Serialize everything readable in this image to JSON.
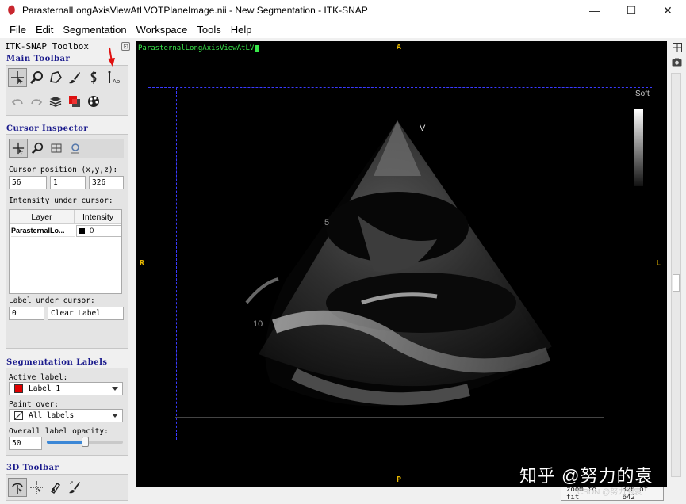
{
  "window": {
    "title": "ParasternalLongAxisViewAtLVOTPlaneImage.nii - New Segmentation - ITK-SNAP",
    "minimize": "—",
    "maximize": "☐",
    "close": "✕"
  },
  "menu": [
    "File",
    "Edit",
    "Segmentation",
    "Workspace",
    "Tools",
    "Help"
  ],
  "toolbox": {
    "title": "ITK-SNAP Toolbox",
    "main_toolbar_title": "Main Toolbar",
    "cursor_inspector_title": "Cursor Inspector",
    "cursor_position_label": "Cursor position (x,y,z):",
    "cursor_x": "56",
    "cursor_y": "1",
    "cursor_z": "326",
    "intensity_label": "Intensity under cursor:",
    "table_headers": [
      "Layer",
      "Intensity"
    ],
    "table_rows": [
      {
        "layer": "ParasternalLo...",
        "intensity": "0"
      }
    ],
    "label_under_cursor_label": "Label under cursor:",
    "label_id": "0",
    "label_name": "Clear Label",
    "segmentation_labels_title": "Segmentation Labels",
    "active_label_label": "Active label:",
    "active_label": "Label 1",
    "active_label_color": "#e00000",
    "paint_over_label": "Paint over:",
    "paint_over": "All labels",
    "opacity_label": "Overall label opacity:",
    "opacity_value": "50",
    "opacity_fraction": 0.5,
    "toolbar_3d_title": "3D Toolbar"
  },
  "viewer": {
    "layer_name": "ParasternalLongAxisViewAtLV",
    "orientation": {
      "top": "A",
      "bottom": "P",
      "left": "R",
      "right": "L"
    },
    "colorbar_label": "Soft",
    "depth_labels": [
      "V",
      "5",
      "10"
    ],
    "zoom_button": "zoom to fit",
    "dimensions_text": "326 of 642"
  },
  "watermark": "知乎 @努力的袁",
  "watermark_small": "CSDN @努力的袁"
}
